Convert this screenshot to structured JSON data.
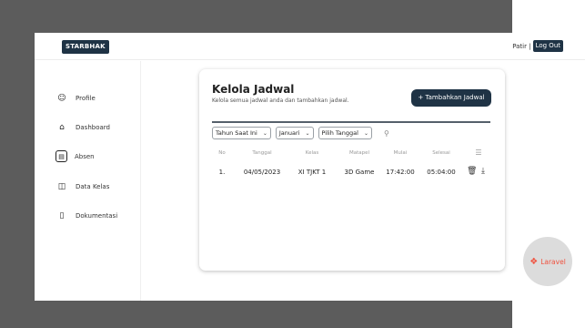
{
  "header": {
    "brand": "STARBHAK",
    "user_name": "Patir |",
    "logout_label": "Log Out"
  },
  "sidebar": {
    "items": [
      {
        "label": "Profile",
        "icon": "user-icon"
      },
      {
        "label": "Dashboard",
        "icon": "home-icon"
      },
      {
        "label": "Absen",
        "icon": "absen-icon",
        "active": true
      },
      {
        "label": "Data Kelas",
        "icon": "book-icon"
      },
      {
        "label": "Dokumentasi",
        "icon": "document-icon"
      }
    ]
  },
  "card": {
    "title": "Kelola Jadwal",
    "description": "Kelola semua jadwal anda dan tambahkan jadwal.",
    "add_button": "+ Tambahkan Jadwal",
    "filters": {
      "year": "Tahun Saat Ini",
      "month": "Januari",
      "date": "Pilih Tanggal"
    },
    "table": {
      "headers": [
        "No",
        "Tanggal",
        "Kelas",
        "Matapel",
        "Mulai",
        "Selesai"
      ],
      "rows": [
        {
          "no": "1.",
          "tanggal": "04/05/2023",
          "kelas": "XI TJKT 1",
          "matapel": "3D Game",
          "mulai": "17:42:00",
          "selesai": "05:04:00"
        }
      ]
    }
  },
  "badge": {
    "label": "Laravel",
    "color": "#f05340"
  },
  "colors": {
    "primary": "#1f3345",
    "backdrop": "#5c5c5c"
  }
}
